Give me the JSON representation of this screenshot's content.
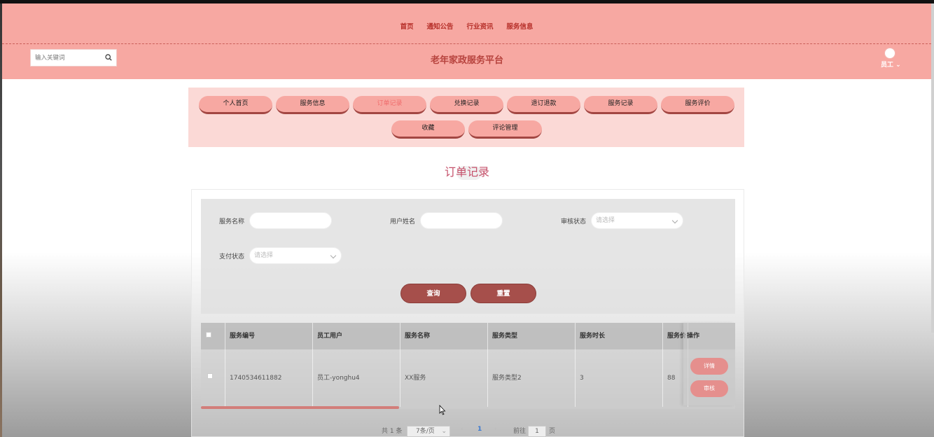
{
  "top_nav": [
    "首页",
    "通知公告",
    "行业资讯",
    "服务信息"
  ],
  "search": {
    "placeholder": "输入关键词"
  },
  "brand": "老年家政服务平台",
  "user": {
    "name": "员工"
  },
  "menu": {
    "row1": [
      "个人首页",
      "服务信息",
      "订单记录",
      "兑换记录",
      "退订退款",
      "服务记录",
      "服务评价"
    ],
    "row2": [
      "收藏",
      "评论管理"
    ],
    "active": "订单记录"
  },
  "page_title": "订单记录",
  "filters": {
    "service_name_label": "服务名称",
    "user_name_label": "用户姓名",
    "audit_status_label": "审核状态",
    "audit_status_placeholder": "请选择",
    "pay_status_label": "支付状态",
    "pay_status_placeholder": "请选择",
    "query_button": "查询",
    "reset_button": "重置"
  },
  "table": {
    "columns": [
      "服务编号",
      "员工用户",
      "服务名称",
      "服务类型",
      "服务时长",
      "服务价",
      "操作"
    ],
    "rows": [
      {
        "id": "1740534611882",
        "staff": "员工-yonghu4",
        "name": "XX服务",
        "type": "服务类型2",
        "duration": "3",
        "price": "88"
      }
    ],
    "actions": [
      "详情",
      "审核"
    ]
  },
  "pagination": {
    "total": "共 1 条",
    "page_size": "7条/页",
    "current_page": "1",
    "goto_label": "前往",
    "goto_value": "1",
    "page_suffix": "页"
  },
  "colors": {
    "header_bg": "#f7a8a2",
    "accent": "#b7302a",
    "button": "#a64f4b"
  }
}
